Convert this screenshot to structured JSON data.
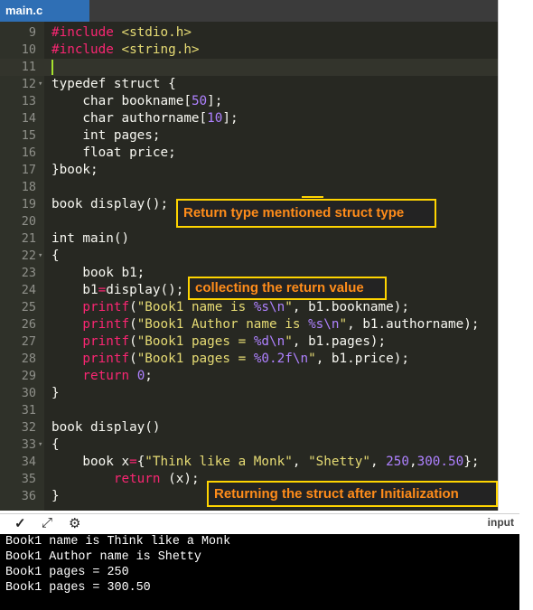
{
  "tab": {
    "title": "main.c"
  },
  "code_lines": [
    {
      "num": "9",
      "fold": "",
      "segs": [
        {
          "c": "r",
          "t": "#include "
        },
        {
          "c": "s",
          "t": "<stdio.h>"
        }
      ]
    },
    {
      "num": "10",
      "fold": "",
      "segs": [
        {
          "c": "r",
          "t": "#include "
        },
        {
          "c": "s",
          "t": "<string.h>"
        }
      ]
    },
    {
      "num": "11",
      "fold": "",
      "segs": [],
      "active": true
    },
    {
      "num": "12",
      "fold": "▾",
      "segs": [
        {
          "c": "k",
          "t": "typedef struct {"
        }
      ]
    },
    {
      "num": "13",
      "fold": "",
      "segs": [
        {
          "c": "k",
          "t": "    char bookname["
        },
        {
          "c": "n",
          "t": "50"
        },
        {
          "c": "k",
          "t": "];"
        }
      ]
    },
    {
      "num": "14",
      "fold": "",
      "segs": [
        {
          "c": "k",
          "t": "    char authorname["
        },
        {
          "c": "n",
          "t": "10"
        },
        {
          "c": "k",
          "t": "];"
        }
      ]
    },
    {
      "num": "15",
      "fold": "",
      "segs": [
        {
          "c": "k",
          "t": "    int pages;"
        }
      ]
    },
    {
      "num": "16",
      "fold": "",
      "segs": [
        {
          "c": "k",
          "t": "    float price;"
        }
      ]
    },
    {
      "num": "17",
      "fold": "",
      "segs": [
        {
          "c": "k",
          "t": "}book;"
        }
      ]
    },
    {
      "num": "18",
      "fold": "",
      "segs": []
    },
    {
      "num": "19",
      "fold": "",
      "segs": [
        {
          "c": "k",
          "t": "book display();"
        }
      ]
    },
    {
      "num": "20",
      "fold": "",
      "segs": []
    },
    {
      "num": "21",
      "fold": "",
      "segs": [
        {
          "c": "k",
          "t": "int main()"
        }
      ]
    },
    {
      "num": "22",
      "fold": "▾",
      "segs": [
        {
          "c": "k",
          "t": "{"
        }
      ]
    },
    {
      "num": "23",
      "fold": "",
      "segs": [
        {
          "c": "k",
          "t": "    book b1;"
        }
      ]
    },
    {
      "num": "24",
      "fold": "",
      "segs": [
        {
          "c": "k",
          "t": "    b1"
        },
        {
          "c": "r",
          "t": "="
        },
        {
          "c": "k",
          "t": "display();"
        }
      ]
    },
    {
      "num": "25",
      "fold": "",
      "segs": [
        {
          "c": "r",
          "t": "    printf"
        },
        {
          "c": "k",
          "t": "("
        },
        {
          "c": "s",
          "t": "\"Book1 name is "
        },
        {
          "c": "n",
          "t": "%s\\n"
        },
        {
          "c": "s",
          "t": "\""
        },
        {
          "c": "k",
          "t": ", b1.bookname);"
        }
      ]
    },
    {
      "num": "26",
      "fold": "",
      "segs": [
        {
          "c": "r",
          "t": "    printf"
        },
        {
          "c": "k",
          "t": "("
        },
        {
          "c": "s",
          "t": "\"Book1 Author name is "
        },
        {
          "c": "n",
          "t": "%s\\n"
        },
        {
          "c": "s",
          "t": "\""
        },
        {
          "c": "k",
          "t": ", b1.authorname);"
        }
      ]
    },
    {
      "num": "27",
      "fold": "",
      "segs": [
        {
          "c": "r",
          "t": "    printf"
        },
        {
          "c": "k",
          "t": "("
        },
        {
          "c": "s",
          "t": "\"Book1 pages = "
        },
        {
          "c": "n",
          "t": "%d\\n"
        },
        {
          "c": "s",
          "t": "\""
        },
        {
          "c": "k",
          "t": ", b1.pages);"
        }
      ]
    },
    {
      "num": "28",
      "fold": "",
      "segs": [
        {
          "c": "r",
          "t": "    printf"
        },
        {
          "c": "k",
          "t": "("
        },
        {
          "c": "s",
          "t": "\"Book1 pages = "
        },
        {
          "c": "n",
          "t": "%0.2f\\n"
        },
        {
          "c": "s",
          "t": "\""
        },
        {
          "c": "k",
          "t": ", b1.price);"
        }
      ]
    },
    {
      "num": "29",
      "fold": "",
      "segs": [
        {
          "c": "r",
          "t": "    return "
        },
        {
          "c": "n",
          "t": "0"
        },
        {
          "c": "k",
          "t": ";"
        }
      ]
    },
    {
      "num": "30",
      "fold": "",
      "segs": [
        {
          "c": "k",
          "t": "}"
        }
      ]
    },
    {
      "num": "31",
      "fold": "",
      "segs": []
    },
    {
      "num": "32",
      "fold": "",
      "segs": [
        {
          "c": "k",
          "t": "book display()"
        }
      ]
    },
    {
      "num": "33",
      "fold": "▾",
      "segs": [
        {
          "c": "k",
          "t": "{"
        }
      ]
    },
    {
      "num": "34",
      "fold": "",
      "segs": [
        {
          "c": "k",
          "t": "    book x"
        },
        {
          "c": "r",
          "t": "="
        },
        {
          "c": "k",
          "t": "{"
        },
        {
          "c": "s",
          "t": "\"Think like a Monk\""
        },
        {
          "c": "k",
          "t": ", "
        },
        {
          "c": "s",
          "t": "\"Shetty\""
        },
        {
          "c": "k",
          "t": ", "
        },
        {
          "c": "n",
          "t": "250"
        },
        {
          "c": "k",
          "t": ","
        },
        {
          "c": "n",
          "t": "300.50"
        },
        {
          "c": "k",
          "t": "};"
        }
      ]
    },
    {
      "num": "35",
      "fold": "",
      "segs": [
        {
          "c": "r",
          "t": "        return "
        },
        {
          "c": "k",
          "t": "(x);"
        }
      ]
    },
    {
      "num": "36",
      "fold": "",
      "segs": [
        {
          "c": "k",
          "t": "}"
        }
      ]
    }
  ],
  "annotations": {
    "return_type": "Return type mentioned struct type",
    "collecting": "collecting the return value",
    "returning": "Returning the struct after Initialization"
  },
  "console": {
    "icons": [
      "chevron-down-icon",
      "expand-icon",
      "settings-icon"
    ],
    "input_label": "input",
    "output": [
      "Book1 name is Think like a Monk",
      "Book1 Author name is Shetty",
      "Book1 pages = 250",
      "Book1 pages = 300.50"
    ]
  }
}
